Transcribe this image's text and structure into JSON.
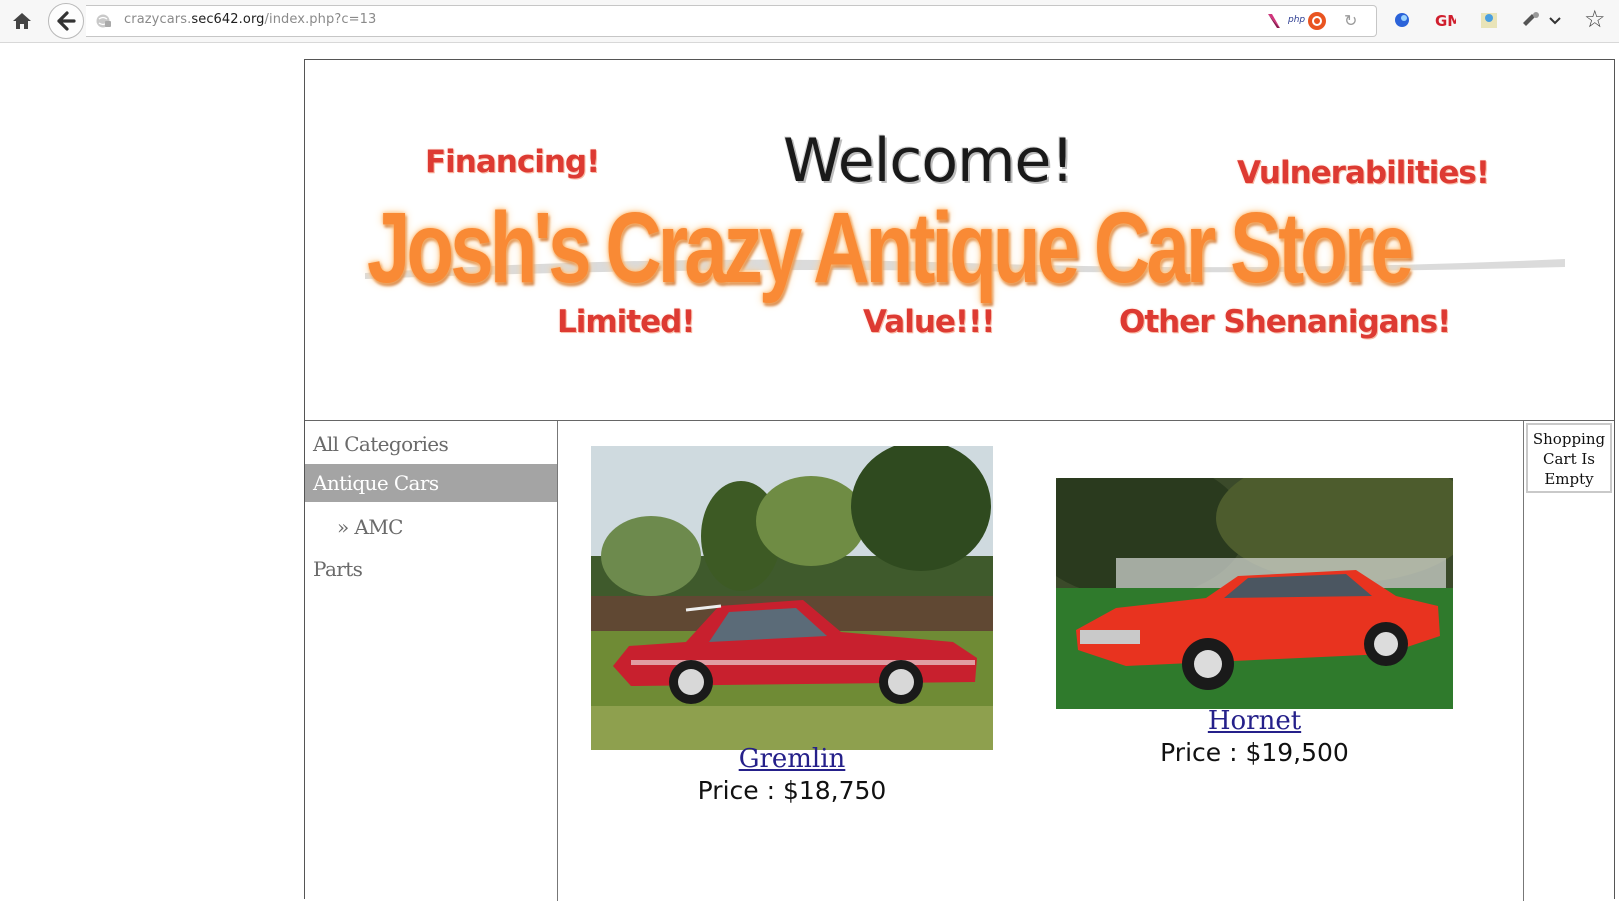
{
  "browser": {
    "url_prefix": "crazycars.",
    "url_host": "sec642.org",
    "url_path": "/index.php?c=13",
    "icons": [
      "home-icon",
      "back-arrow-icon",
      "site-info-icon",
      "addon-php-icon",
      "addon-ubuntu-icon",
      "reload-icon",
      "addon-blue-icon",
      "addon-gm-icon",
      "addon-map-icon",
      "addon-tools-icon",
      "bookmark-star-icon"
    ],
    "php_label": "php"
  },
  "banner": {
    "welcome": "Welcome!",
    "store_name": "Josh's Crazy Antique Car Store",
    "taglines": {
      "financing": "Financing!",
      "vulnerabilities": "Vulnerabilities!",
      "limited": "Limited!",
      "value": "Value!!!",
      "shenanigans": "Other Shenanigans!"
    },
    "tag_color": "#dd3a32",
    "store_color": "#f98a35"
  },
  "nav": {
    "items": [
      {
        "label": "All Categories",
        "active": false
      },
      {
        "label": "Antique Cars",
        "active": true
      },
      {
        "label": "» AMC",
        "active": false
      },
      {
        "label": "Parts",
        "active": false
      }
    ],
    "active_bg": "#a4a4a4"
  },
  "products": [
    {
      "name": "Gremlin",
      "price": "Price : $18,750",
      "car_color": "#c8202e"
    },
    {
      "name": "Hornet",
      "price": "Price : $19,500",
      "car_color": "#e8331f"
    }
  ],
  "cart": {
    "line1": "Shopping",
    "line2": "Cart Is",
    "line3": "Empty"
  }
}
